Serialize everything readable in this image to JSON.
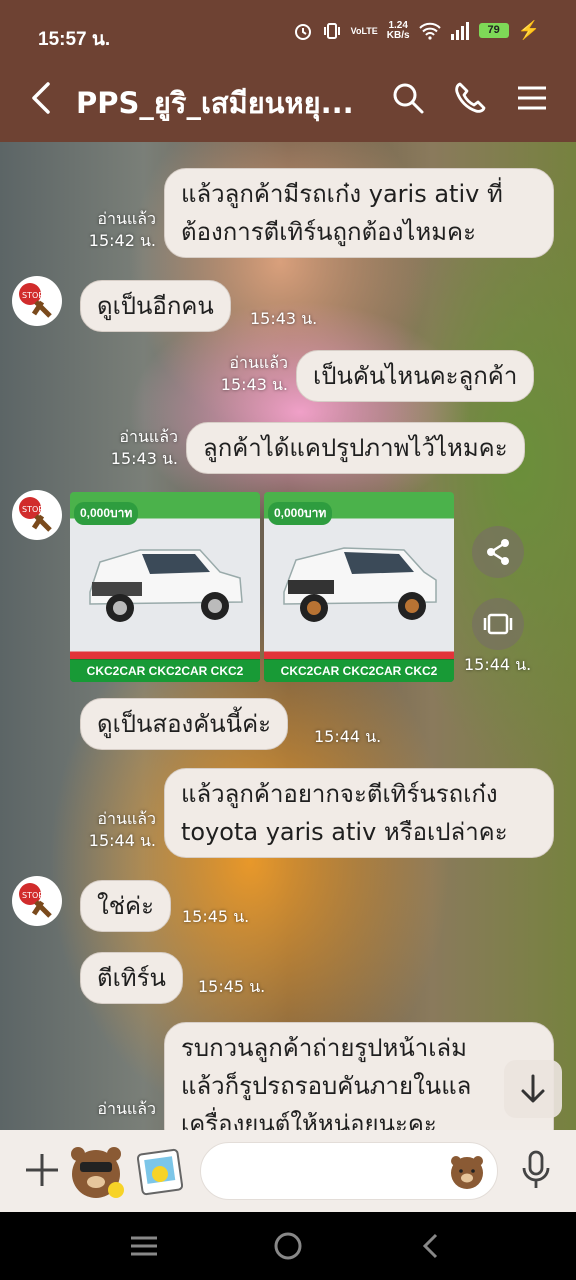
{
  "status": {
    "time": "15:57 น.",
    "network_label": "VoLTE",
    "speed_value": "1.24",
    "speed_unit": "KB/s",
    "battery": "79"
  },
  "header": {
    "title": "PPS_ยูริ_เสมียนหยุ..."
  },
  "messages": [
    {
      "side": "right",
      "lines": [
        "แล้วลูกค้ามีรถเก๋ง yaris ativ ที่",
        "ต้องการตีเทิร์นถูกต้องไหมคะ"
      ],
      "read": "อ่านแล้ว",
      "time": "15:42 น."
    },
    {
      "side": "left",
      "text": "ดูเป็นอีกคน",
      "time": "15:43 น."
    },
    {
      "side": "right",
      "text": "เป็นคันไหนคะลูกค้า",
      "read": "อ่านแล้ว",
      "time": "15:43 น."
    },
    {
      "side": "right",
      "text": "ลูกค้าได้แคปรูปภาพไว้ไหมคะ",
      "read": "อ่านแล้ว",
      "time": "15:43 น."
    },
    {
      "side": "left",
      "type": "photos",
      "time": "15:44 น.",
      "photos": [
        {
          "promo": "0,000บาท",
          "band": "CKC2CAR CKC2CAR CKC2"
        },
        {
          "promo": "0,000บาท",
          "band": "CKC2CAR CKC2CAR CKC2"
        }
      ]
    },
    {
      "side": "left",
      "text": "ดูเป็นสองคันนี้ค่ะ",
      "time": "15:44 น."
    },
    {
      "side": "right",
      "lines": [
        "แล้วลูกค้าอยากจะตีเทิร์นรถเก๋ง",
        "toyota yaris ativ หรือเปล่าคะ"
      ],
      "read": "อ่านแล้ว",
      "time": "15:44 น."
    },
    {
      "side": "left",
      "text": "ใช่ค่ะ",
      "time": "15:45 น."
    },
    {
      "side": "left",
      "text": "ตีเทิร์น",
      "time": "15:45 น."
    },
    {
      "side": "right",
      "lines": [
        "รบกวนลูกค้าถ่ายรูปหน้าเล่ม",
        "แล้วก็รูปรถรอบคันภายในแล",
        "เครื่องยนต์ให้หน่อยนะคะ"
      ],
      "read": "อ่านแล้ว"
    }
  ],
  "input": {
    "placeholder": ""
  },
  "icons": {
    "header": [
      "back-arrow-icon",
      "search-icon",
      "phone-icon",
      "menu-icon"
    ],
    "input": [
      "plus-icon",
      "sticker-icon",
      "photo-sticker-icon",
      "emoji-icon",
      "mic-icon"
    ],
    "nav": [
      "recent-apps-icon",
      "home-icon",
      "back-icon"
    ]
  },
  "colors": {
    "header_bg": "#6e4233",
    "bubble_bg": "#f1ebe6",
    "battery": "#7ed957"
  }
}
